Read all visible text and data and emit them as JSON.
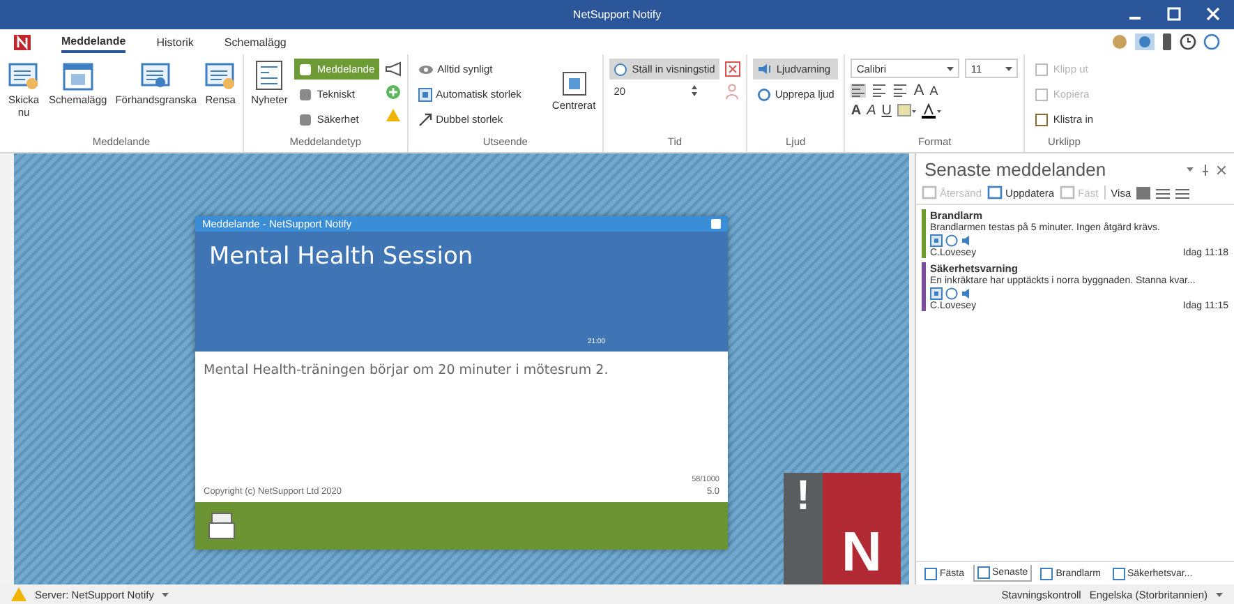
{
  "window": {
    "title": "NetSupport Notify"
  },
  "ribbon_tabs": [
    {
      "label": "Meddelande",
      "selected": true
    },
    {
      "label": "Historik",
      "selected": false
    },
    {
      "label": "Schemalägg",
      "selected": false
    }
  ],
  "ribbon": {
    "meddelande": {
      "label": "Meddelande",
      "buttons": [
        {
          "label": "Skicka nu",
          "kind": "send"
        },
        {
          "label": "Schemalägg",
          "kind": "calendar"
        },
        {
          "label": "Förhandsgranska",
          "kind": "preview"
        },
        {
          "label": "Rensa",
          "kind": "clear"
        }
      ]
    },
    "typ": {
      "label": "Meddelandetyp",
      "large": "Nyheter",
      "types": [
        {
          "label": "Meddelande",
          "selected": true
        },
        {
          "label": "Tekniskt",
          "selected": false
        },
        {
          "label": "Säkerhet",
          "selected": false
        }
      ]
    },
    "utseende": {
      "label": "Utseende",
      "options": [
        {
          "label": "Alltid synligt",
          "kind": "eye"
        },
        {
          "label": "Automatisk storlek",
          "kind": "auto"
        },
        {
          "label": "Dubbel storlek",
          "kind": "double"
        }
      ],
      "center": "Centrerat"
    },
    "tid": {
      "label": "Tid",
      "toggle": {
        "label": "Ställ in visningstid",
        "on": true
      },
      "value": "20"
    },
    "ljud": {
      "label": "Ljud",
      "toggle": {
        "label": "Ljudvarning",
        "on": true
      },
      "repeat": "Upprepa ljud"
    },
    "format": {
      "label": "Format",
      "font": "Calibri",
      "size": "11",
      "styles": [
        {
          "label": "A",
          "kind": "bold"
        },
        {
          "label": "A",
          "kind": "italic"
        },
        {
          "label": "U",
          "kind": "underline"
        }
      ],
      "sizes": [
        {
          "label": "A",
          "kind": "grow"
        },
        {
          "label": "A",
          "kind": "shrink"
        }
      ]
    },
    "urklipp": {
      "label": "Urklipp",
      "items": [
        {
          "label": "Klipp ut",
          "disabled": true
        },
        {
          "label": "Kopiera",
          "disabled": true
        },
        {
          "label": "Klistra in",
          "disabled": false
        }
      ]
    }
  },
  "popup": {
    "title": "Meddelande - NetSupport Notify",
    "heading": "Mental Health Session",
    "time": "21:00",
    "body": "Mental Health-träningen börjar om 20 minuter i mötesrum 2.",
    "count": "58/1000",
    "copyright": "Copyright (c) NetSupport Ltd 2020",
    "version": "5.0"
  },
  "logo": {
    "mark": "!",
    "letter": "N"
  },
  "panel": {
    "title": "Senaste meddelanden",
    "toolbar": [
      {
        "label": "Återsänd",
        "disabled": true
      },
      {
        "label": "Uppdatera",
        "disabled": false
      },
      {
        "label": "Fäst",
        "disabled": true
      }
    ],
    "view_label": "Visa",
    "messages": [
      {
        "title": "Brandlarm",
        "text": "Brandlarmen testas på 5 minuter. Ingen åtgärd krävs.",
        "sender": "C.Lovesey",
        "time": "Idag 11:18",
        "color": "#6e9a2e"
      },
      {
        "title": "Säkerhetsvarning",
        "text": "En inkräktare har upptäckts i norra byggnaden. Stanna kvar...",
        "sender": "C.Lovesey",
        "time": "Idag 11:15",
        "color": "#7b4f9c"
      }
    ],
    "tabs": [
      {
        "label": "Fästa",
        "selected": false
      },
      {
        "label": "Senaste",
        "selected": true
      },
      {
        "label": "Brandlarm",
        "selected": false
      },
      {
        "label": "Säkerhetsvar...",
        "selected": false
      }
    ]
  },
  "status_bar": {
    "server": "Server: NetSupport Notify",
    "spell": "Stavningskontroll",
    "language": "Engelska (Storbritannien)"
  }
}
